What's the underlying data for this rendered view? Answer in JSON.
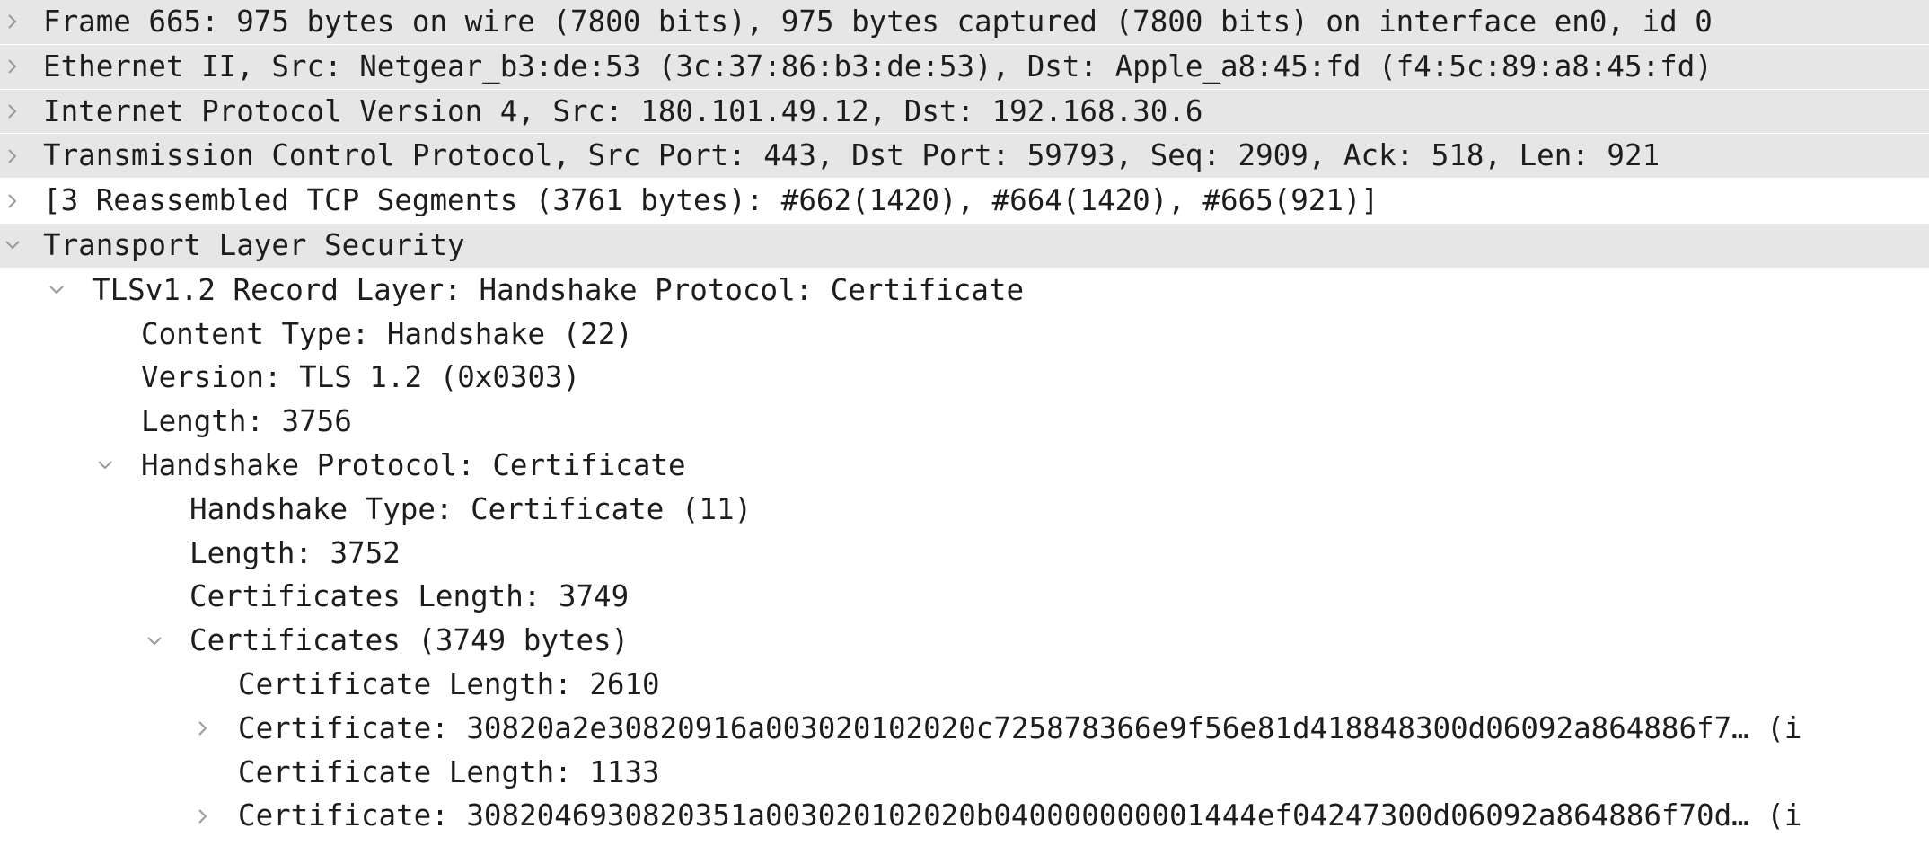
{
  "tree": {
    "rows": [
      {
        "label": "Frame 665: 975 bytes on wire (7800 bits), 975 bytes captured (7800 bits) on interface en0, id 0",
        "expanded": false
      },
      {
        "label": "Ethernet II, Src: Netgear_b3:de:53 (3c:37:86:b3:de:53), Dst: Apple_a8:45:fd (f4:5c:89:a8:45:fd)",
        "expanded": false
      },
      {
        "label": "Internet Protocol Version 4, Src: 180.101.49.12, Dst: 192.168.30.6",
        "expanded": false
      },
      {
        "label": "Transmission Control Protocol, Src Port: 443, Dst Port: 59793, Seq: 2909, Ack: 518, Len: 921",
        "expanded": false
      },
      {
        "label": "[3 Reassembled TCP Segments (3761 bytes): #662(1420), #664(1420), #665(921)]",
        "expanded": false
      },
      {
        "label": "Transport Layer Security",
        "expanded": true
      },
      {
        "label": "TLSv1.2 Record Layer: Handshake Protocol: Certificate",
        "expanded": true
      },
      {
        "label": "Content Type: Handshake (22)"
      },
      {
        "label": "Version: TLS 1.2 (0x0303)"
      },
      {
        "label": "Length: 3756"
      },
      {
        "label": "Handshake Protocol: Certificate",
        "expanded": true
      },
      {
        "label": "Handshake Type: Certificate (11)"
      },
      {
        "label": "Length: 3752"
      },
      {
        "label": "Certificates Length: 3749"
      },
      {
        "label": "Certificates (3749 bytes)",
        "expanded": true
      },
      {
        "label": "Certificate Length: 2610"
      },
      {
        "label": "Certificate: 30820a2e30820916a003020102020c725878366e9f56e81d418848300d06092a864886f7… (i",
        "expanded": false
      },
      {
        "label": "Certificate Length: 1133"
      },
      {
        "label": "Certificate: 3082046930820351a003020102020b040000000001444ef04247300d06092a864886f70d… (i",
        "expanded": false
      }
    ]
  },
  "colors": {
    "row_highlight": "#e6e6e6",
    "text": "#1d1d1d",
    "disclosure": "#9a9a9a"
  },
  "icons": {
    "collapsed": "chevron-right-icon",
    "expanded": "chevron-down-icon"
  }
}
